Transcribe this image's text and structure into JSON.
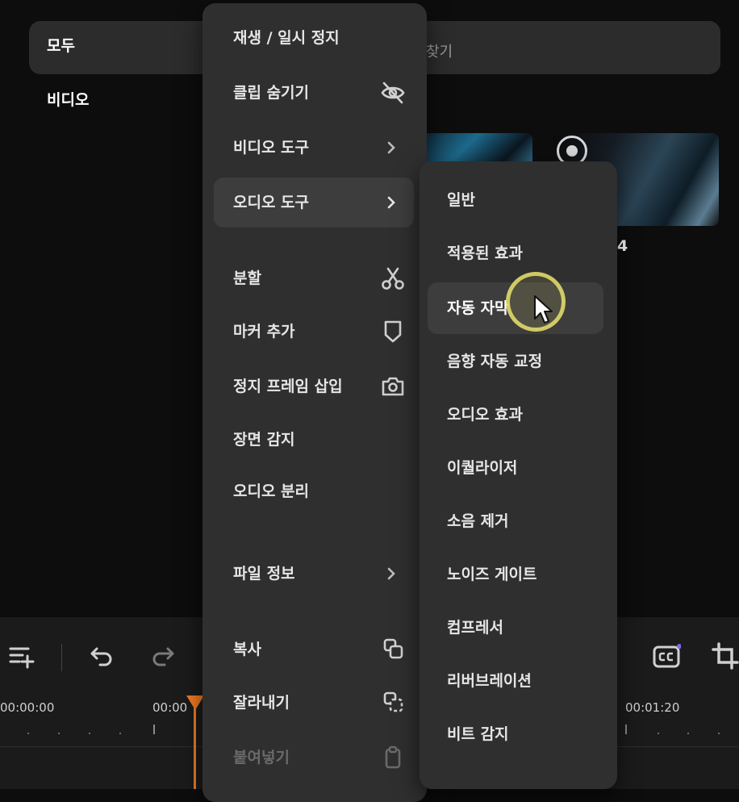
{
  "filter": {
    "all_label": "모두",
    "search_placeholder": "찾기",
    "category_video": "비디오"
  },
  "media": {
    "clip_number": "4"
  },
  "timeline": {
    "timecodes": [
      "00:00:00",
      "00:00",
      "00:01:20"
    ]
  },
  "context_menu": {
    "items": [
      {
        "label": "재생 / 일시 정지"
      },
      {
        "label": "클립 숨기기",
        "icon": "eye-off-icon"
      },
      {
        "label": "비디오 도구",
        "icon": "chevron-right-icon"
      },
      {
        "label": "오디오 도구",
        "icon": "chevron-right-icon"
      },
      {
        "label": "분할",
        "icon": "scissors-icon"
      },
      {
        "label": "마커 추가",
        "icon": "marker-icon"
      },
      {
        "label": "정지 프레임 삽입",
        "icon": "camera-icon"
      },
      {
        "label": "장면 감지"
      },
      {
        "label": "오디오 분리"
      },
      {
        "label": "파일 정보",
        "icon": "chevron-right-icon"
      },
      {
        "label": "복사",
        "icon": "copy-icon"
      },
      {
        "label": "잘라내기",
        "icon": "cut-icon"
      },
      {
        "label": "붙여넣기",
        "icon": "paste-icon",
        "disabled": true
      }
    ]
  },
  "audio_submenu": {
    "items": [
      {
        "label": "일반"
      },
      {
        "label": "적용된 효과"
      },
      {
        "label": "자동 자막"
      },
      {
        "label": "음향 자동 교정"
      },
      {
        "label": "오디오 효과"
      },
      {
        "label": "이퀄라이저"
      },
      {
        "label": "소음 제거"
      },
      {
        "label": "노이즈 게이트"
      },
      {
        "label": "컴프레서"
      },
      {
        "label": "리버브레이션"
      },
      {
        "label": "비트 감지"
      }
    ]
  },
  "colors": {
    "accent_playhead": "#f07b22",
    "cursor_highlight": "#e8e06e"
  }
}
